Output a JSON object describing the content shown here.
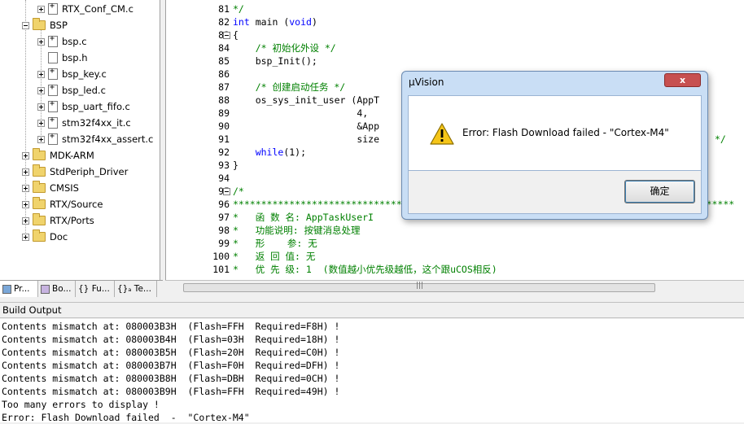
{
  "tree": {
    "items": [
      {
        "label": "RTX_Conf_CM.c",
        "kind": "src"
      },
      {
        "label": "BSP",
        "kind": "folder"
      },
      {
        "label": "bsp.c",
        "kind": "src"
      },
      {
        "label": "bsp.h",
        "kind": "hdr"
      },
      {
        "label": "bsp_key.c",
        "kind": "src"
      },
      {
        "label": "bsp_led.c",
        "kind": "src"
      },
      {
        "label": "bsp_uart_fifo.c",
        "kind": "src"
      },
      {
        "label": "stm32f4xx_it.c",
        "kind": "src"
      },
      {
        "label": "stm32f4xx_assert.c",
        "kind": "src"
      },
      {
        "label": "MDK-ARM",
        "kind": "folder"
      },
      {
        "label": "StdPeriph_Driver",
        "kind": "folder"
      },
      {
        "label": "CMSIS",
        "kind": "folder"
      },
      {
        "label": "RTX/Source",
        "kind": "folder"
      },
      {
        "label": "RTX/Ports",
        "kind": "folder"
      },
      {
        "label": "Doc",
        "kind": "folder"
      }
    ]
  },
  "tabs": [
    {
      "label": "Pr..."
    },
    {
      "label": "Bo..."
    },
    {
      "label": "{} Fu..."
    },
    {
      "label": "{}ₐ Te..."
    }
  ],
  "editor": {
    "lines": [
      {
        "n": "81",
        "text": "*/"
      },
      {
        "n": "82",
        "text": "int main (void)"
      },
      {
        "n": "83",
        "text": "{"
      },
      {
        "n": "84",
        "text": "    /* 初始化外设 */"
      },
      {
        "n": "85",
        "text": "    bsp_Init();"
      },
      {
        "n": "86",
        "text": ""
      },
      {
        "n": "87",
        "text": "    /* 创建启动任务 */"
      },
      {
        "n": "88",
        "text": "    os_sys_init_user (AppT"
      },
      {
        "n": "89",
        "text": "                      4,"
      },
      {
        "n": "90",
        "text": "                      &App"
      },
      {
        "n": "91",
        "text": "                      size"
      },
      {
        "n": "92",
        "text": "    while(1);"
      },
      {
        "n": "93",
        "text": "}"
      },
      {
        "n": "94",
        "text": ""
      },
      {
        "n": "95",
        "text": "/*"
      },
      {
        "n": "96",
        "text": "*****************************************************************************************"
      },
      {
        "n": "97",
        "text": "*   函 数 名: AppTaskUserI"
      },
      {
        "n": "98",
        "text": "*   功能说明: 按键消息处理"
      },
      {
        "n": "99",
        "text": "*   形    参: 无"
      },
      {
        "n": "100",
        "text": "*   返 回 值: 无"
      },
      {
        "n": "101",
        "text": "*   优 先 级: 1  (数值越小优先级越低，这个跟uCOS相反)"
      }
    ],
    "tail_comment": "*/"
  },
  "build_output": {
    "title": "Build Output",
    "lines": [
      "Contents mismatch at: 080003B3H  (Flash=FFH  Required=F8H) !",
      "Contents mismatch at: 080003B4H  (Flash=03H  Required=18H) !",
      "Contents mismatch at: 080003B5H  (Flash=20H  Required=C0H) !",
      "Contents mismatch at: 080003B7H  (Flash=F0H  Required=DFH) !",
      "Contents mismatch at: 080003B8H  (Flash=DBH  Required=0CH) !",
      "Contents mismatch at: 080003B9H  (Flash=FFH  Required=49H) !",
      "Too many errors to display !",
      "Error: Flash Download failed  -  \"Cortex-M4\""
    ]
  },
  "dialog": {
    "title": "µVision",
    "close_label": "x",
    "message": "Error: Flash Download failed  -  \"Cortex-M4\"",
    "ok_label": "确定",
    "icon": "warning-icon"
  },
  "colors": {
    "keyword": "#0000ff",
    "comment": "#008000",
    "folder": "#f0d36c"
  }
}
